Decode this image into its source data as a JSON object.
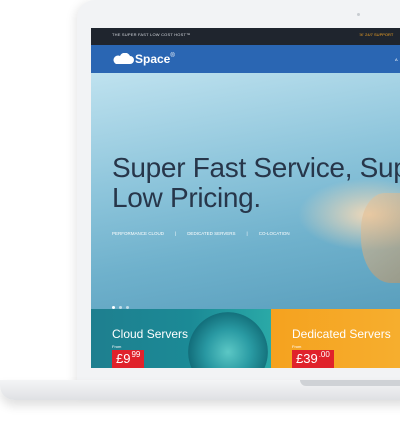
{
  "topbar": {
    "tagline": "THE SUPER FAST LOW COST HOST™",
    "support": "☏ 24/7 SUPPORT"
  },
  "header": {
    "logo_text": "Space",
    "logo_mark": "®",
    "nav_partial": "A"
  },
  "hero": {
    "title_line1": "Super Fast Service, Supe",
    "title_line2": "Low Pricing.",
    "links": [
      "PERFORMANCE CLOUD",
      "DEDICATED SERVERS",
      "CO-LOCATION"
    ],
    "separator": "|",
    "slide_count": 3,
    "active_slide": 1
  },
  "cards": [
    {
      "title": "Cloud Servers",
      "from": "From",
      "price_main": "£9",
      "price_cents": "99"
    },
    {
      "title": "Dedicated Servers",
      "from": "From",
      "price_main": "£39",
      "price_cents": ".00"
    }
  ],
  "colors": {
    "topbar": "#1f252e",
    "header": "#2a66b3",
    "cloud_card": "#1b8a96",
    "dedicated_card": "#f5a21f",
    "price_badge": "#e0222b",
    "support_text": "#f5a524",
    "hero_title": "#27364a"
  }
}
